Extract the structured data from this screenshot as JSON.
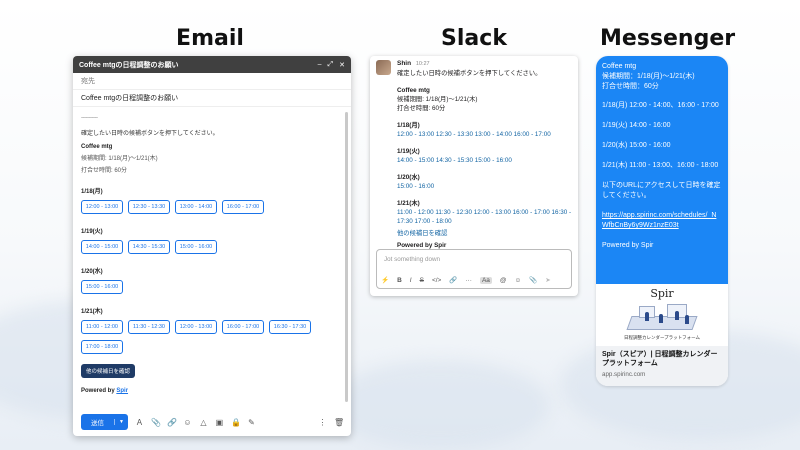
{
  "sections": {
    "email": "Email",
    "slack": "Slack",
    "messenger": "Messenger"
  },
  "gmail": {
    "window_title": "Coffee mtgの日程調整のお願い",
    "controls": [
      "–",
      "⤢",
      "✕"
    ],
    "to_label": "宛先",
    "subject": "Coffee mtgの日程調整のお願い",
    "dash": "-----------",
    "intro": "確定したい日時の候補ボタンを押下してください。",
    "event_title": "Coffee mtg",
    "period": "候補期間: 1/18(月)〜1/21(木)",
    "duration": "打合せ時間: 60分",
    "days": [
      {
        "date": "1/18(月)",
        "slots": [
          "12:00 - 13:00",
          "12:30 - 13:30",
          "13:00 - 14:00",
          "16:00 - 17:00"
        ]
      },
      {
        "date": "1/19(火)",
        "slots": [
          "14:00 - 15:00",
          "14:30 - 15:30",
          "15:00 - 16:00"
        ]
      },
      {
        "date": "1/20(水)",
        "slots": [
          "15:00 - 16:00"
        ]
      },
      {
        "date": "1/21(木)",
        "slots": [
          "11:00 - 12:00",
          "11:30 - 12:30",
          "12:00 - 13:00",
          "16:00 - 17:00",
          "16:30 - 17:30",
          "17:00 - 18:00"
        ]
      }
    ],
    "confirm_button": "他の候補日を確認",
    "powered_by": "Powered by",
    "powered_link": "Spir",
    "send_label": "送信",
    "send_dropdown": "▼",
    "toolbar_icons": [
      "A",
      "📎",
      "🔗",
      "☺",
      "△",
      "▣",
      "🔒",
      "✎"
    ],
    "toolbar_more": "⋮",
    "toolbar_trash": "🗑"
  },
  "slack": {
    "name": "Shin",
    "time": "10:27",
    "intro": "確定したい日時の候補ボタンを押下してください。",
    "event_title": "Coffee mtg",
    "period": "候補期間: 1/18(月)〜1/21(木)",
    "duration": "打合せ時間: 60分",
    "days": [
      {
        "date": "1/18(月)",
        "line1": "12:00 - 13:00 12:30 - 13:30 13:00 - 14:00 16:00 - 17:00",
        "line2": ""
      },
      {
        "date": "1/19(火)",
        "line1": "14:00 - 15:00 14:30 - 15:30 15:00 - 16:00",
        "line2": ""
      },
      {
        "date": "1/20(水)",
        "line1": "15:00 - 16:00",
        "line2": ""
      },
      {
        "date": "1/21(木)",
        "line1": "11:00 - 12:00 11:30 - 12:30 12:00 - 13:00 16:00 - 17:00 16:30 - 17:30 17:00 - 18:00",
        "line2": ""
      }
    ],
    "other_link": "他の候補日を確認",
    "powered": "Powered by Spir",
    "input_placeholder": "Jot something down",
    "tools": [
      "⚡",
      "B",
      "I",
      "S",
      "</>",
      "🔗",
      "···",
      "Aa",
      "@",
      "☺",
      "📎",
      "➤"
    ]
  },
  "messenger": {
    "event_title": "Coffee mtg",
    "period": "候補期間：1/18(月)〜1/21(木)",
    "duration": "打合せ時間：60分",
    "day1": "1/18(月) 12:00 - 14:00、16:00 - 17:00",
    "day2": "1/19(火) 14:00 - 16:00",
    "day3": "1/20(水) 15:00 - 16:00",
    "day4": "1/21(木) 11:00 - 13:00、16:00 - 18:00",
    "url_intro": "以下のURLにアクセスして日時を確定してください。",
    "url": "https://app.spirinc.com/schedules/_NWfbCnBy6y9Wz1nzE03t",
    "powered": "Powered by Spir",
    "card_logo": "Spir",
    "card_caption": "日程調整カレンダープラットフォーム",
    "card_title": "Spir（スピア）| 日程調整カレンダープラットフォーム",
    "card_url": "app.spirinc.com"
  }
}
